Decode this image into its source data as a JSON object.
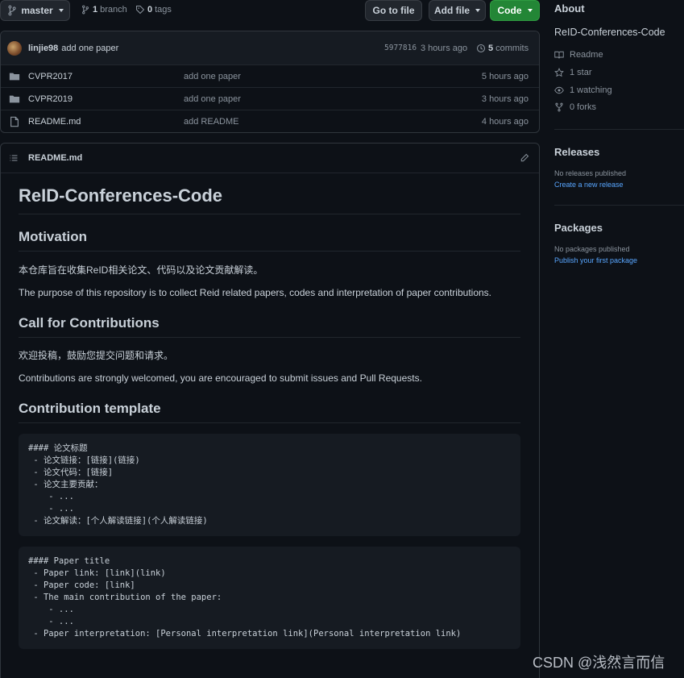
{
  "toolbar": {
    "branch_select": "master",
    "branch_count": "1",
    "branch_label": "branch",
    "tag_count": "0",
    "tag_label": "tags",
    "go_to_file": "Go to file",
    "add_file": "Add file",
    "code": "Code"
  },
  "commit": {
    "author": "linjie98",
    "message": "add one paper",
    "hash": "5977816",
    "time": "3 hours ago",
    "count": "5",
    "count_label": "commits"
  },
  "files": [
    {
      "name": "CVPR2017",
      "type": "folder",
      "message": "add one paper",
      "time": "5 hours ago"
    },
    {
      "name": "CVPR2019",
      "type": "folder",
      "message": "add one paper",
      "time": "3 hours ago"
    },
    {
      "name": "README.md",
      "type": "file",
      "message": "add README",
      "time": "4 hours ago"
    }
  ],
  "readme": {
    "filename": "README.md",
    "title": "ReID-Conferences-Code",
    "h_motivation": "Motivation",
    "p_motivation_zh": "本仓库旨在收集ReID相关论文、代码以及论文贡献解读。",
    "p_motivation_en": "The purpose of this repository is to collect Reid related papers, codes and interpretation of paper contributions.",
    "h_call": "Call for Contributions",
    "p_call_zh": "欢迎投稿，鼓励您提交问题和请求。",
    "p_call_en": "Contributions are strongly welcomed, you are encouraged to submit issues and Pull Requests.",
    "h_template": "Contribution template",
    "code_zh": "#### 论文标题\n - 论文链接：[链接](链接)\n - 论文代码：[链接]\n - 论文主要贡献：\n    - ...\n    - ...\n - 论文解读：[个人解读链接](个人解读链接)",
    "code_en": "#### Paper title\n - Paper link: [link](link)\n - Paper code: [link]\n - The main contribution of the paper:\n    - ...\n    - ...\n - Paper interpretation: [Personal interpretation link](Personal interpretation link)"
  },
  "sidebar": {
    "about_heading": "About",
    "repo_name": "ReID-Conferences-Code",
    "readme": "Readme",
    "stars": "1 star",
    "watching": "1 watching",
    "forks": "0 forks",
    "releases_heading": "Releases",
    "no_releases": "No releases published",
    "create_release": "Create a new release",
    "packages_heading": "Packages",
    "no_packages": "No packages published",
    "publish_package": "Publish your first package"
  },
  "watermark": "CSDN @浅然言而信",
  "colors": {
    "background": "#0d1117",
    "code_button": "#238636",
    "link": "#58a6ff"
  }
}
